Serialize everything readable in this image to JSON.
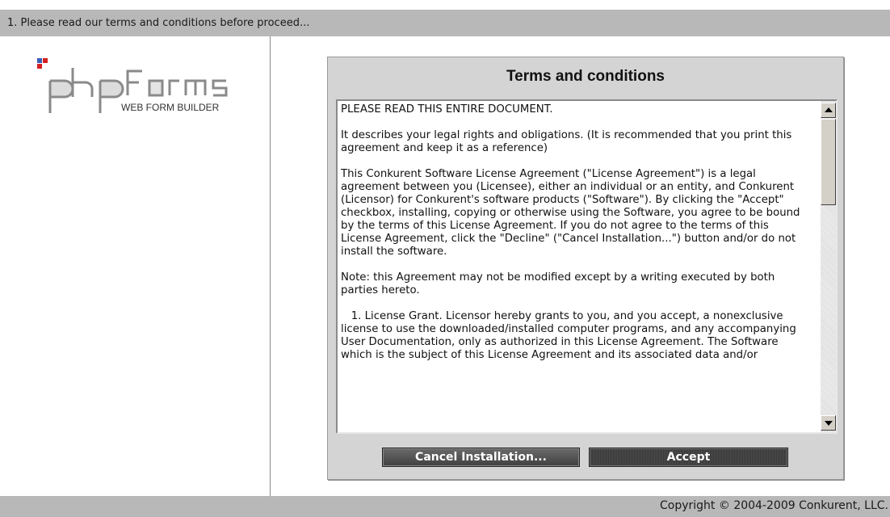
{
  "header": {
    "step_text": "1. Please read our terms and conditions before proceed..."
  },
  "logo": {
    "brand": "phpForms",
    "tagline": "WEB FORM BUILDER"
  },
  "terms": {
    "title": "Terms and conditions",
    "paragraphs": [
      "PLEASE READ THIS ENTIRE DOCUMENT.",
      "It describes your legal rights and obligations. (It is recommended that you print this agreement and keep it as a reference)",
      "This Conkurent Software License Agreement (\"License Agreement\") is a legal agreement between you (Licensee), either an individual or an entity, and Conkurent (Licensor) for Conkurent's software products (\"Software\"). By clicking the \"Accept\" checkbox, installing, copying or otherwise using the Software, you agree to be bound by the terms of this License Agreement. If you do not agree to the terms of this License Agreement, click the \"Decline\" (\"Cancel Installation...\") button and/or do not install the software.",
      "Note: this Agreement may not be modified except by a writing executed by both parties hereto.",
      "   1. License Grant. Licensor hereby grants to you, and you accept, a nonexclusive license to use the downloaded/installed computer programs, and any accompanying User Documentation, only as authorized in this License Agreement. The Software which is the subject of this License Agreement and its associated data and/or"
    ]
  },
  "buttons": {
    "cancel_label": "Cancel Installation...",
    "accept_label": "Accept"
  },
  "footer": {
    "copyright": "Copyright © 2004-2009 Conkurent, LLC."
  }
}
